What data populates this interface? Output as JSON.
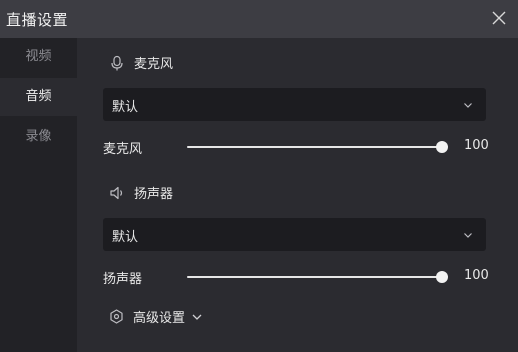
{
  "window": {
    "title": "直播设置"
  },
  "sidebar": {
    "items": [
      {
        "label": "视频",
        "active": false
      },
      {
        "label": "音频",
        "active": true
      },
      {
        "label": "录像",
        "active": false
      }
    ]
  },
  "microphone": {
    "section_title": "麦克风",
    "device_selected": "默认",
    "volume_label": "麦克风",
    "volume_value": "100",
    "volume_fraction": 1.0
  },
  "speaker": {
    "section_title": "扬声器",
    "device_selected": "默认",
    "volume_label": "扬声器",
    "volume_value": "100",
    "volume_fraction": 1.0
  },
  "advanced": {
    "label": "高级设置"
  },
  "colors": {
    "titlebar": "#3d3d43",
    "sidebar": "#222226",
    "panel": "#2b2b30",
    "select": "#1c1c20",
    "text": "#e8e8e8",
    "muted": "#8c8c92"
  },
  "icons": {
    "close": "close-icon",
    "microphone": "microphone-icon",
    "speaker": "speaker-icon",
    "settings": "hexagon-settings-icon",
    "dropdown": "chevron-down-icon"
  }
}
